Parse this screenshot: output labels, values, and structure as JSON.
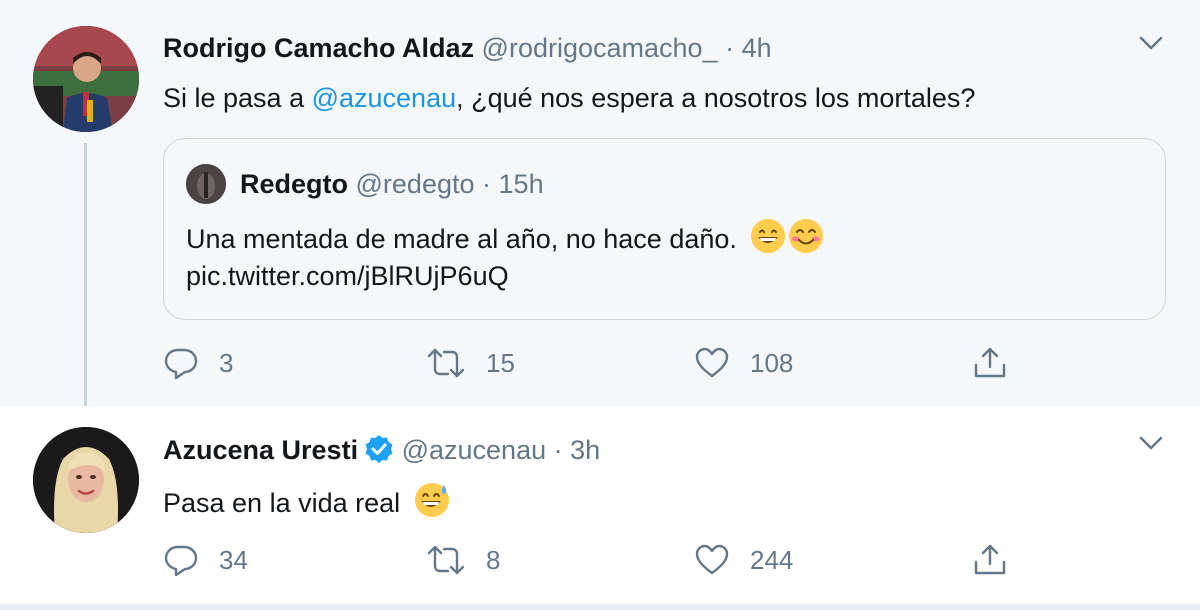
{
  "tweets": [
    {
      "name": "Rodrigo Camacho Aldaz",
      "handle": "@rodrigocamacho_",
      "separator": "·",
      "time": "4h",
      "text_before": "Si le pasa a ",
      "mention": "@azucenau",
      "text_after": ", ¿qué nos espera a nosotros los mortales?",
      "quote": {
        "name": "Redegto",
        "handle": "@redegto",
        "separator": "·",
        "time": "15h",
        "text": "Una mentada de madre al año, no hace daño.",
        "emojis": [
          "grinning-face-emoji",
          "smiling-face-blush-emoji"
        ],
        "link": "pic.twitter.com/jBlRUjP6uQ"
      },
      "actions": {
        "replies": "3",
        "retweets": "15",
        "likes": "108"
      }
    },
    {
      "name": "Azucena Uresti",
      "verified": true,
      "handle": "@azucenau",
      "separator": "·",
      "time": "3h",
      "text": "Pasa en la vida real",
      "emojis": [
        "grinning-sweat-emoji"
      ],
      "actions": {
        "replies": "34",
        "retweets": "8",
        "likes": "244"
      }
    }
  ],
  "colors": {
    "link": "#1b95e0",
    "secondary_text": "#657786",
    "verified_badge": "#1da1f2",
    "icon": "#657786"
  }
}
